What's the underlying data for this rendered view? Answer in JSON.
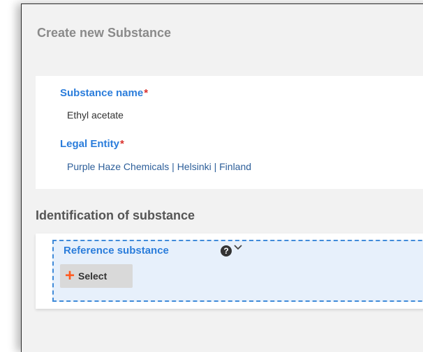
{
  "dialog": {
    "title": "Create new Substance"
  },
  "fields": {
    "substance_name": {
      "label": "Substance name",
      "required_marker": "*",
      "value": "Ethyl acetate"
    },
    "legal_entity": {
      "label": "Legal Entity",
      "required_marker": "*",
      "value": "Purple Haze Chemicals | Helsinki | Finland"
    }
  },
  "identification": {
    "section_title": "Identification of substance",
    "reference_substance": {
      "label": "Reference substance",
      "help_icon": "question-circle-icon",
      "help_glyph": "?",
      "chevron_icon": "chevron-down-icon",
      "select_icon": "plus-icon",
      "select_glyph": "+",
      "select_label": "Select"
    }
  },
  "colors": {
    "label_blue": "#2b7ddb",
    "required_red": "#d9302c",
    "plus_orange": "#ff5a1f",
    "drop_zone_bg": "#e7f0fb",
    "drop_zone_border": "#3f8ad9"
  }
}
